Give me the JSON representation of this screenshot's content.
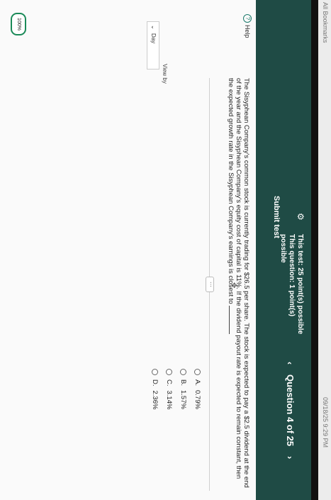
{
  "browser": {
    "bookmarks": "All Bookmarks",
    "clock": "09/18/25 9:29 PM"
  },
  "header": {
    "question_label": "Question 4 of 25",
    "test_points": "This test: 25 point(s) possible",
    "question_points": "This question: 1 point(s) possible",
    "submit_label": "Submit test"
  },
  "help_label": "Help",
  "view_by_label": "View by",
  "view_by_value": "Day",
  "zoom_level": "100%",
  "question": {
    "text": "The Sisyphean Company's common stock is currently trading for $26.5 per share. The stock is expected to pay a $2.5 dividend at the end of the year and the Sisyphean Company's equity cost of capital is 11%. If the dividend payout rate is expected to remain constant, then the expected growth rate in the Sisyphean Company's earnings is closest to"
  },
  "options": [
    {
      "letter": "A.",
      "value": "0.79%"
    },
    {
      "letter": "B.",
      "value": "1.57%"
    },
    {
      "letter": "C.",
      "value": "3.14%"
    },
    {
      "letter": "D.",
      "value": "2.36%"
    }
  ]
}
